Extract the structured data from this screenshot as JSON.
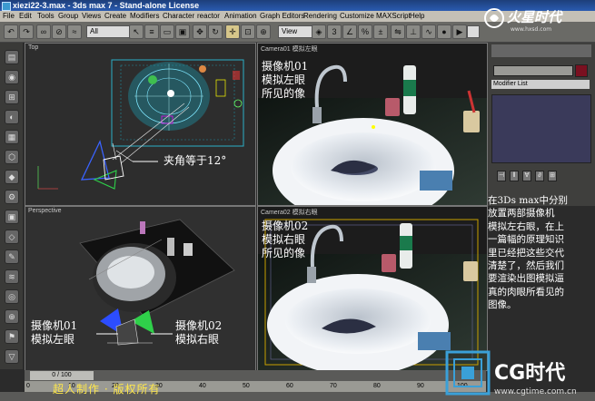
{
  "window": {
    "title": "xiezi22-3.max - 3ds max 7 - Stand-alone License"
  },
  "menu": [
    "File",
    "Edit",
    "Tools",
    "Group",
    "Views",
    "Create",
    "Modifiers",
    "Character",
    "reactor",
    "Animation",
    "Graph Editors",
    "Rendering",
    "Customize",
    "MAXScript",
    "Help"
  ],
  "toolbar": {
    "selection_filter": "All",
    "view_dropdown": "View"
  },
  "viewports": {
    "top": {
      "label": "Top",
      "angle_note": "夹角等于12°"
    },
    "camera01": {
      "label": "Camera01 模拟左眼",
      "caption_line1": "摄像机01",
      "caption_line2": "模拟左眼",
      "caption_line3": "所见的像"
    },
    "perspective": {
      "label": "Perspective",
      "cam1_line1": "摄像机01",
      "cam1_line2": "模拟左眼",
      "cam2_line1": "摄像机02",
      "cam2_line2": "模拟右眼"
    },
    "camera02": {
      "label": "Camera02 模拟右眼",
      "caption_line1": "摄像机02",
      "caption_line2": "模拟右眼",
      "caption_line3": "所见的像"
    }
  },
  "command_panel": {
    "modifier_list": "Modifier List"
  },
  "note": {
    "lines": [
      "在3Ds max中分别",
      "放置两部摄像机",
      "模拟左右眼，在上",
      "一篇幅的原理知识",
      "里已经把这些交代",
      "清楚了，然后我们",
      "要渲染出图模拟逼",
      "真的肉眼所看见的",
      "图像。"
    ]
  },
  "timeline": {
    "frame": "0 / 100",
    "ticks": [
      "0",
      "10",
      "20",
      "30",
      "40",
      "50",
      "60",
      "70",
      "80",
      "90",
      "100"
    ]
  },
  "credit": "超人制作 · 版权所有",
  "logos": {
    "top_text": "火星时代",
    "top_url": "www.hxsd.com",
    "bottom_text": "CG时代",
    "bottom_url": "www.cgtime.com.cn"
  },
  "colors": {
    "title_bar": "#2a5bb0",
    "menu_bg": "#c4c0b6",
    "credit": "#ffe84a",
    "modifier_stack": "#3a3a5a"
  }
}
